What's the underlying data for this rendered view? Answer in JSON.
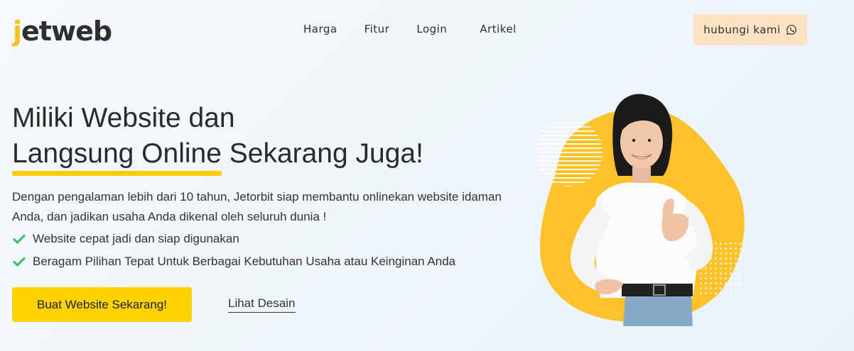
{
  "brand": {
    "logo_j": "j",
    "logo_rest": "etweb"
  },
  "nav": {
    "items": [
      "Harga",
      "Fitur",
      "Login",
      "Artikel"
    ]
  },
  "header": {
    "contact_label": "hubungi kami"
  },
  "hero": {
    "line1": "Miliki Website dan",
    "highlight": "Langsung Online",
    "line2_rest": " Sekarang Juga!",
    "description": "Dengan pengalaman lebih dari 10 tahun, Jetorbit siap membantu onlinekan website idaman Anda, dan jadikan usaha Anda dikenal oleh seluruh dunia !",
    "features": [
      "Website cepat jadi dan siap digunakan",
      "Beragam Pilihan Tepat Untuk Berbagai Kebutuhan Usaha atau Keinginan Anda"
    ],
    "cta_label": "Buat Website Sekarang!",
    "secondary_label": "Lihat Desain"
  },
  "colors": {
    "accent_yellow": "#ffd200",
    "logo_yellow": "#f4c21f",
    "contact_bg": "#fde3c4",
    "check_green": "#3fbf6a"
  },
  "icons": {
    "contact": "whatsapp-icon",
    "feature": "check-icon"
  }
}
